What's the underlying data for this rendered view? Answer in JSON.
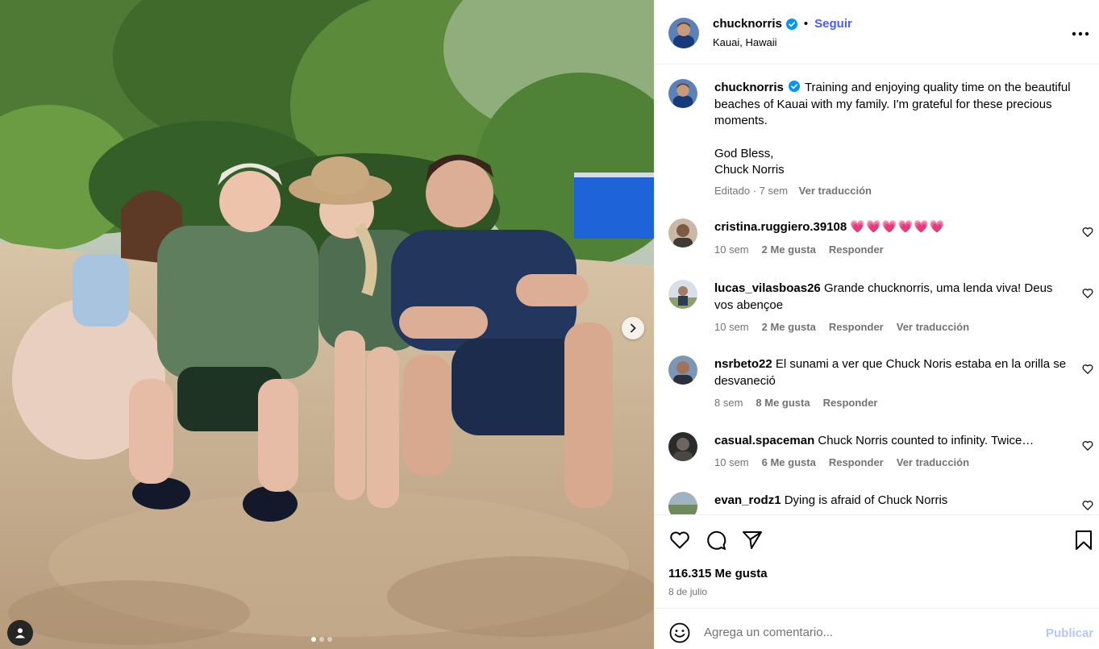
{
  "post": {
    "author": {
      "username": "chucknorris",
      "verified": true,
      "follow_label": "Seguir",
      "separator": "•",
      "location": "Kauai, Hawaii"
    },
    "more_icon": "more-horizontal-icon",
    "media": {
      "next_icon": "chevron-right-icon",
      "carousel_slide": 1,
      "carousel_total": 3,
      "tag_icon": "user-tag-icon"
    },
    "caption": {
      "username": "chucknorris",
      "line1": "Training and enjoying quality time on the beautiful beaches of Kauai with my family. I'm grateful for these precious moments.",
      "line2": "God Bless,",
      "line3": "Chuck Norris",
      "edited": "Editado · 7 sem",
      "translate": "Ver traducción"
    },
    "comments": [
      {
        "username": "cristina.ruggiero.39108",
        "text": "💗💗💗💗💗💗",
        "time": "10 sem",
        "likes": "2 Me gusta",
        "reply": "Responder",
        "translate": ""
      },
      {
        "username": "lucas_vilasboas26",
        "text": "Grande chucknorris, uma lenda viva! Deus vos abençoe",
        "time": "10 sem",
        "likes": "2 Me gusta",
        "reply": "Responder",
        "translate": "Ver traducción"
      },
      {
        "username": "nsrbeto22",
        "text": "El sunami a ver que Chuck Noris estaba en la orilla se desvaneció",
        "time": "8 sem",
        "likes": "8 Me gusta",
        "reply": "Responder",
        "translate": ""
      },
      {
        "username": "casual.spaceman",
        "text": "Chuck Norris counted to infinity. Twice…",
        "time": "10 sem",
        "likes": "6 Me gusta",
        "reply": "Responder",
        "translate": "Ver traducción"
      },
      {
        "username": "evan_rodz1",
        "text": "Dying is afraid of Chuck Norris",
        "time": "",
        "likes": "",
        "reply": "",
        "translate": ""
      }
    ],
    "actions": {
      "like_icon": "heart-icon",
      "comment_icon": "comment-icon",
      "share_icon": "paper-plane-icon",
      "save_icon": "bookmark-icon"
    },
    "likes": "116.315 Me gusta",
    "date": "8 de julio",
    "composer": {
      "emoji_icon": "emoji-icon",
      "placeholder": "Agrega un comentario...",
      "publish_label": "Publicar"
    },
    "colors": {
      "link_blue": "#4a5df9",
      "publish_disabled": "#b5c6fb",
      "meta_gray": "#737373",
      "verified_blue": "#0095f6",
      "heart_pink": "#e83e8c"
    }
  }
}
